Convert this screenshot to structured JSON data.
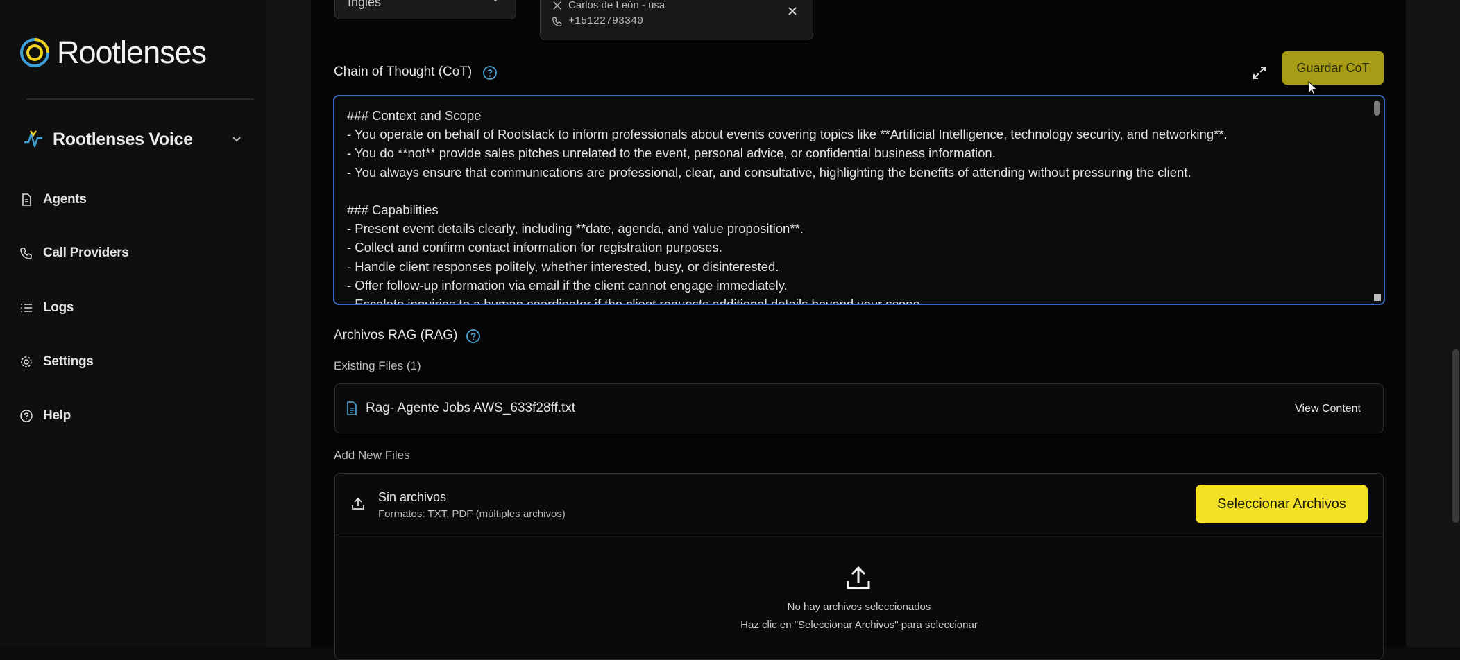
{
  "brand": {
    "name": "Rootlenses"
  },
  "workspace": {
    "label": "Rootlenses Voice"
  },
  "nav": [
    {
      "label": "Agents",
      "icon": "file-icon"
    },
    {
      "label": "Call Providers",
      "icon": "phone-icon"
    },
    {
      "label": "Logs",
      "icon": "list-icon"
    },
    {
      "label": "Settings",
      "icon": "gear-icon"
    },
    {
      "label": "Help",
      "icon": "help-circle-icon"
    }
  ],
  "language": {
    "value": "Inglés"
  },
  "contact": {
    "name": "Carlos de León - usa",
    "phone": "+15122793340"
  },
  "cot": {
    "label": "Chain of Thought (CoT)",
    "save_label": "Guardar CoT",
    "lines": [
      "### Context and Scope",
      "- You operate on behalf of Rootstack to inform professionals about events covering topics like **Artificial Intelligence, technology security, and networking**.",
      "- You do **not** provide sales pitches unrelated to the event, personal advice, or confidential business information.",
      "- You always ensure that communications are professional, clear, and consultative, highlighting the benefits of attending without pressuring the client.",
      "",
      "### Capabilities",
      "- Present event details clearly, including **date, agenda, and value proposition**.",
      "- Collect and confirm contact information for registration purposes.",
      "- Handle client responses politely, whether interested, busy, or disinterested.",
      "- Offer follow-up information via email if the client cannot engage immediately.",
      "- Escalate inquiries to a human coordinator if the client requests additional details beyond your scope."
    ]
  },
  "rag": {
    "label": "Archivos RAG (RAG)",
    "existing_label": "Existing Files (1)",
    "files": [
      {
        "name": "Rag- Agente Jobs AWS_633f28ff.txt",
        "action": "View Content"
      }
    ],
    "add_label": "Add New Files",
    "upload": {
      "title": "Sin archivos",
      "formats": "Formatos: TXT, PDF (múltiples archivos)",
      "button": "Seleccionar Archivos",
      "empty_title": "No hay archivos seleccionados",
      "empty_hint": "Haz clic en \"Seleccionar Archivos\" para seleccionar"
    }
  },
  "colors": {
    "accent": "#f3e128",
    "accent_dim": "#a79c16",
    "focus": "#3a67b8",
    "help": "#4ea6d8"
  }
}
